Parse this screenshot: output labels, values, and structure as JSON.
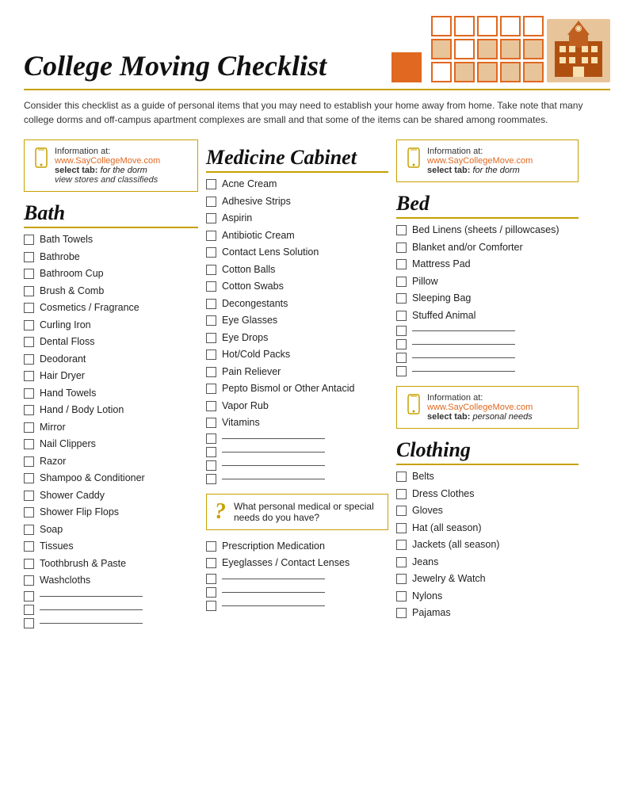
{
  "header": {
    "title": "College Moving Checklist",
    "intro": "Consider this checklist as a guide of personal items that you may need to establish your home away from home.  Take note that many college dorms and off-campus apartment complexes are small and that some of the items can be shared among roommates."
  },
  "info_box_1": {
    "label": "Information at:",
    "url": "www.SayCollegeMove.com",
    "select_tab_label": "select tab:",
    "tab_value": "for the dorm",
    "sub_text": "view stores and classifieds"
  },
  "info_box_2": {
    "label": "Information at:",
    "url": "www.SayCollegeMove.com",
    "select_tab_label": "select tab:",
    "tab_value": "for the dorm"
  },
  "info_box_3": {
    "label": "Information at:",
    "url": "www.SayCollegeMove.com",
    "select_tab_label": "select tab:",
    "tab_value": "personal needs"
  },
  "bath": {
    "title": "Bath",
    "items": [
      "Bath Towels",
      "Bathrobe",
      "Bathroom Cup",
      "Brush & Comb",
      "Cosmetics / Fragrance",
      "Curling Iron",
      "Dental Floss",
      "Deodorant",
      "Hair Dryer",
      "Hand Towels",
      "Hand / Body Lotion",
      "Mirror",
      "Nail Clippers",
      "Razor",
      "Shampoo & Conditioner",
      "Shower Caddy",
      "Shower Flip Flops",
      "Soap",
      "Tissues",
      "Toothbrush & Paste",
      "Washcloths"
    ]
  },
  "medicine_cabinet": {
    "title": "Medicine Cabinet",
    "items": [
      "Acne Cream",
      "Adhesive Strips",
      "Aspirin",
      "Antibiotic Cream",
      "Contact Lens Solution",
      "Cotton Balls",
      "Cotton Swabs",
      "Decongestants",
      "Eye Glasses",
      "Eye Drops",
      "Hot/Cold Packs",
      "Pain Reliever",
      "Pepto Bismol or Other Antacid",
      "Vapor Rub",
      "Vitamins"
    ],
    "question_text": "What personal medical or special needs do you have?",
    "extra_items": [
      "Prescription Medication",
      "Eyeglasses / Contact Lenses"
    ]
  },
  "bed": {
    "title": "Bed",
    "items": [
      "Bed Linens (sheets / pillowcases)",
      "Blanket and/or Comforter",
      "Mattress Pad",
      "Pillow",
      "Sleeping Bag",
      "Stuffed Animal"
    ]
  },
  "clothing": {
    "title": "Clothing",
    "items": [
      "Belts",
      "Dress Clothes",
      "Gloves",
      "Hat (all season)",
      "Jackets (all season)",
      "Jeans",
      "Jewelry & Watch",
      "Nylons",
      "Pajamas"
    ]
  }
}
